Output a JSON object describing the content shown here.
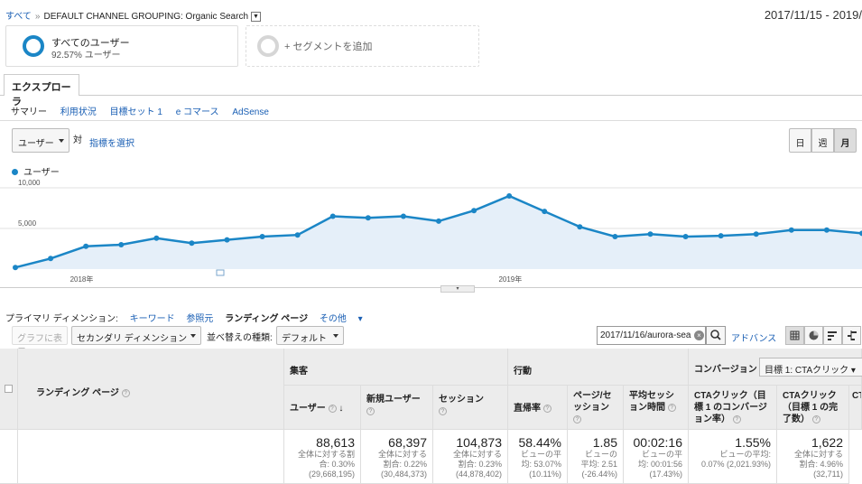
{
  "breadcrumb": {
    "root": "すべて",
    "sep": "»",
    "current": "DEFAULT CHANNEL GROUPING: Organic Search"
  },
  "date_range": "2017/11/15 - 2019/",
  "segments": {
    "all_users_title": "すべてのユーザー",
    "all_users_sub": "92.57% ユーザー",
    "add_segment": "+ セグメントを追加"
  },
  "tabs": {
    "explorer": "エクスプローラ"
  },
  "subtabs": [
    "サマリー",
    "利用状況",
    "目標セット 1",
    "e コマース",
    "AdSense"
  ],
  "metric": {
    "selected": "ユーザー",
    "vs": "対",
    "choose": "指標を選択"
  },
  "period_buttons": {
    "day": "日",
    "week": "週",
    "month": "月"
  },
  "legend": {
    "label": "ユーザー"
  },
  "chart_data": {
    "type": "area",
    "series": [
      {
        "name": "ユーザー",
        "values": [
          200,
          1300,
          2800,
          3000,
          3800,
          3200,
          3600,
          4000,
          4200,
          6500,
          6300,
          6500,
          5900,
          7200,
          9000,
          7100,
          5200,
          4000,
          4300,
          4000,
          4100,
          4300,
          4800,
          4800,
          4400
        ]
      }
    ],
    "y_ticks": [
      "10,000",
      "5,000"
    ],
    "x_tick_labels": [
      "2018年",
      "2019年"
    ],
    "ylim": [
      0,
      10000
    ],
    "grid": true,
    "color": "#1b86c6",
    "fill": "#e5eff9"
  },
  "primary_dimension": {
    "label": "プライマリ ディメンション:",
    "options": [
      "キーワード",
      "参照元",
      "ランディング ページ",
      "その他"
    ]
  },
  "toolbar": {
    "graph_button": "グラフに表示",
    "secondary_dimension": "セカンダリ ディメンション",
    "sort_label": "並べ替えの種類:",
    "sort_value": "デフォルト",
    "filter_value": "2017/11/16/aurora-sea",
    "advanced": "アドバンス"
  },
  "table": {
    "dimension_header": "ランディング ページ",
    "groups": {
      "acquisition": "集客",
      "behavior": "行動",
      "conversion": "コンバージョン",
      "goal_select": "目標 1: CTAクリック"
    },
    "columns": [
      "ユーザー",
      "新規ユーザー",
      "セッション",
      "直帰率",
      "ページ/セッション",
      "平均セッション時間",
      "CTAクリック（目標 1 のコンバージョン率）",
      "CTAクリック（目標 1 の完了数）",
      "CT"
    ],
    "totals": [
      {
        "value": "88,613",
        "sub1": "全体に対する割",
        "sub2": "合: 0.30%",
        "sub3": "(29,668,195)"
      },
      {
        "value": "68,397",
        "sub1": "全体に対する",
        "sub2": "割合: 0.22%",
        "sub3": "(30,484,373)"
      },
      {
        "value": "104,873",
        "sub1": "全体に対する",
        "sub2": "割合: 0.23%",
        "sub3": "(44,878,402)"
      },
      {
        "value": "58.44%",
        "sub1": "ビューの平",
        "sub2": "均: 53.07%",
        "sub3": "(10.11%)"
      },
      {
        "value": "1.85",
        "sub1": "ビューの",
        "sub2": "平均: 2.51",
        "sub3": "(-26.44%)"
      },
      {
        "value": "00:02:16",
        "sub1": "ビューの平",
        "sub2": "均: 00:01:56",
        "sub3": "(17.43%)"
      },
      {
        "value": "1.55%",
        "sub1": "ビューの平均:",
        "sub2": "0.07% (2,021.93%)",
        "sub3": ""
      },
      {
        "value": "1,622",
        "sub1": "全体に対する",
        "sub2": "割合: 4.96%",
        "sub3": "(32,711)"
      }
    ]
  }
}
